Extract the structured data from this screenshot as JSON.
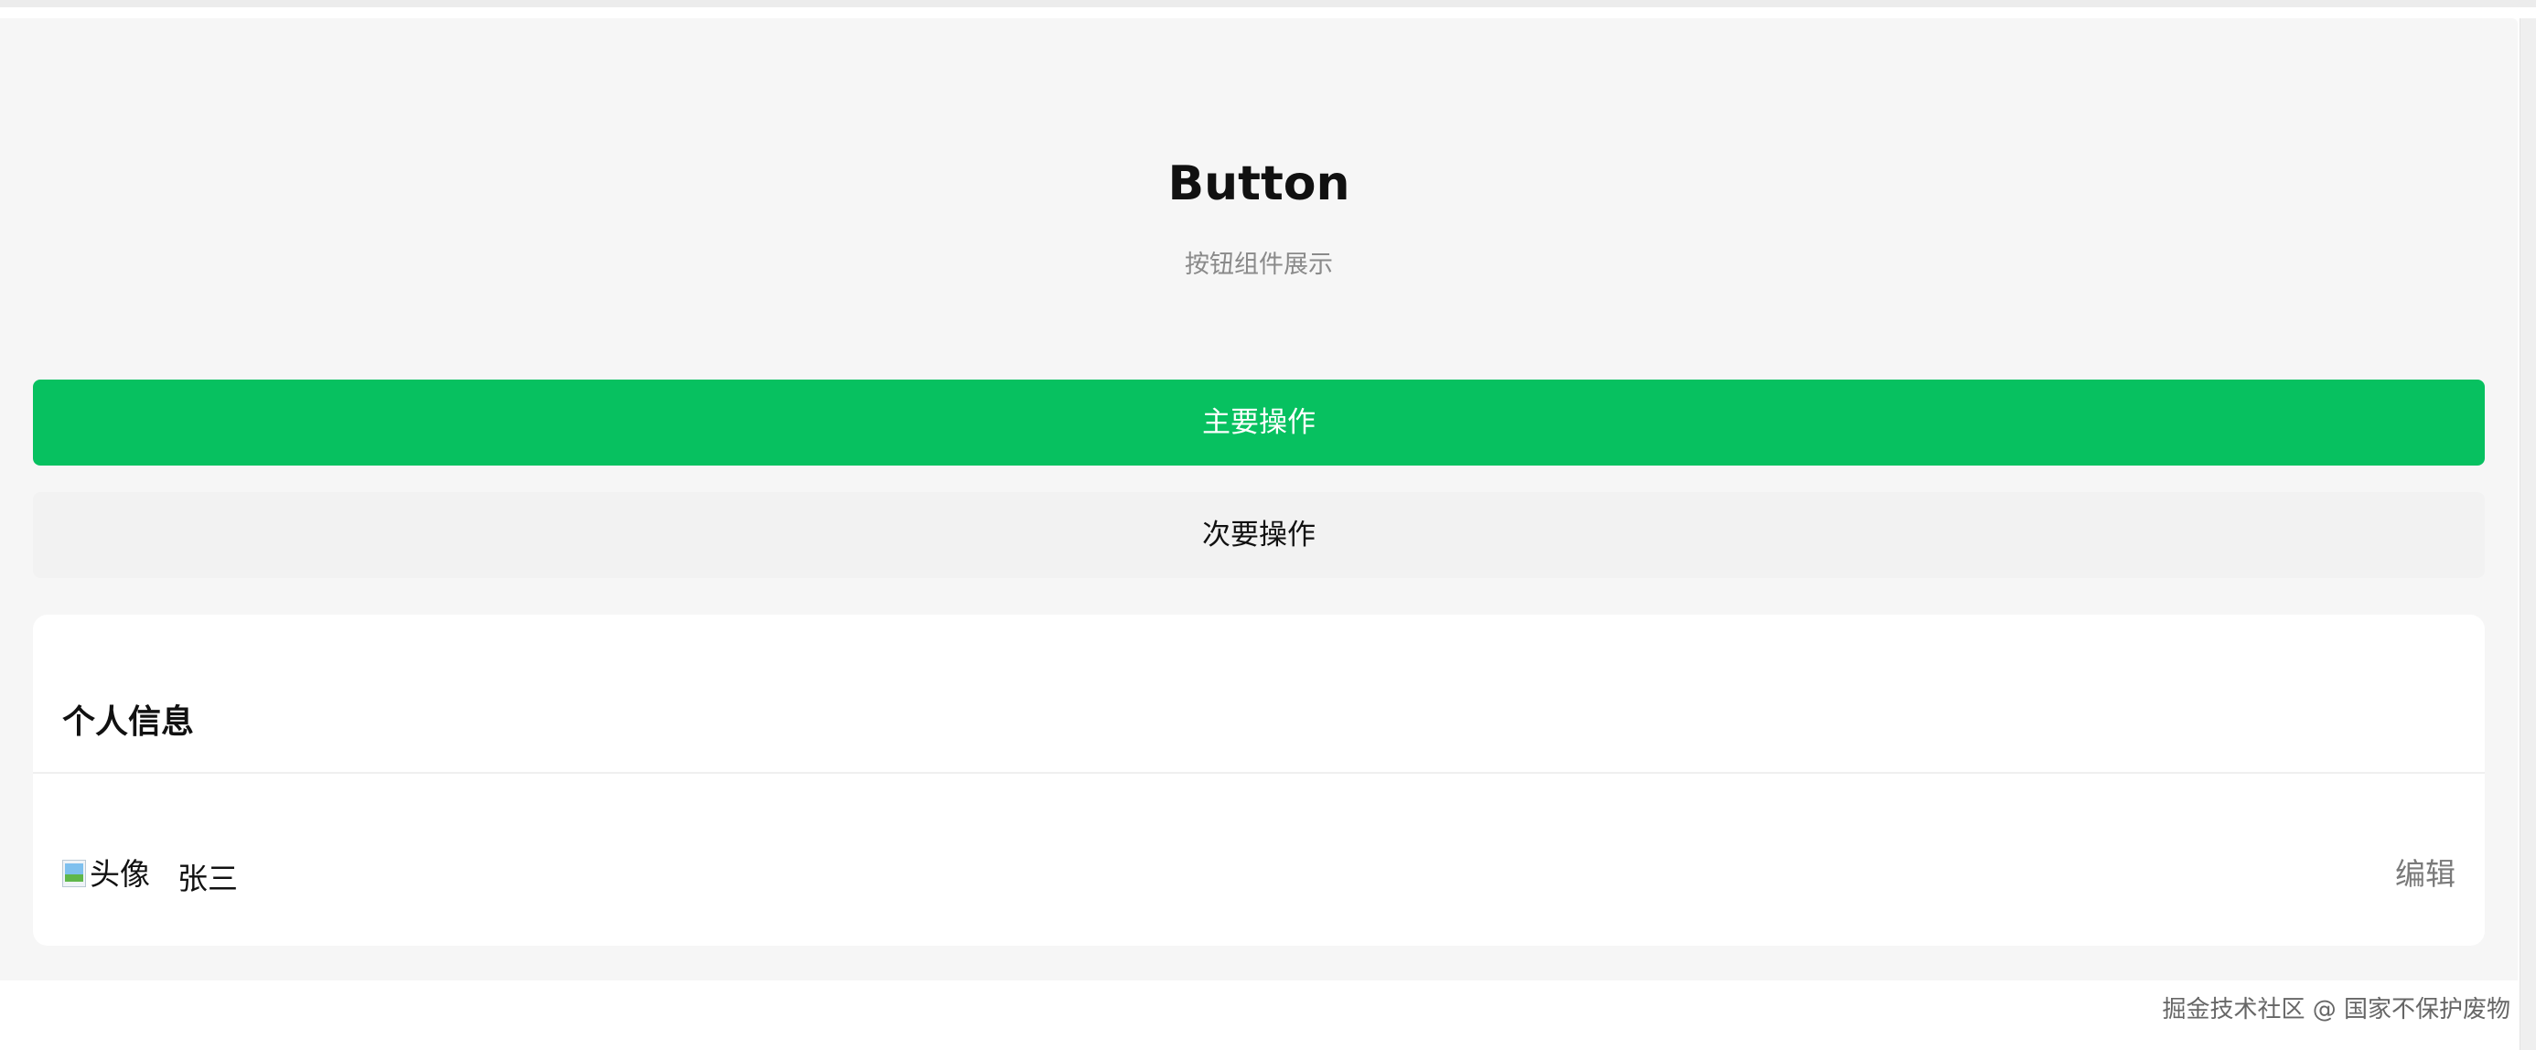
{
  "header": {
    "title": "Button",
    "subtitle": "按钮组件展示"
  },
  "buttons": {
    "primary_label": "主要操作",
    "secondary_label": "次要操作"
  },
  "profile_card": {
    "title": "个人信息",
    "avatar_alt": "头像",
    "name": "张三",
    "edit_label": "编辑"
  },
  "watermark": "掘金技术社区 @ 国家不保护废物",
  "colors": {
    "primary": "#07c160",
    "secondary_bg": "#f2f2f2",
    "page_bg": "#f6f6f6"
  }
}
